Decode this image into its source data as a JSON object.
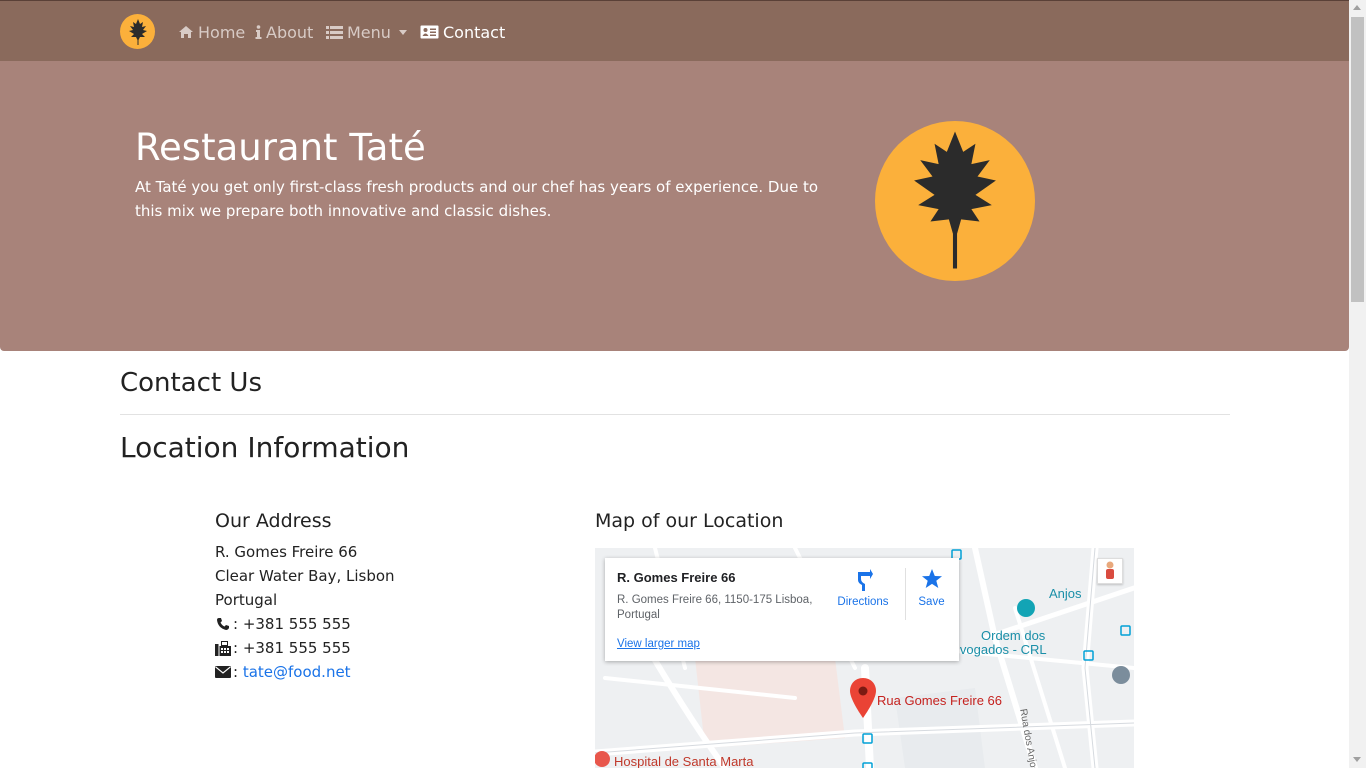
{
  "nav": {
    "items": [
      {
        "label": "Home",
        "icon": "home-icon"
      },
      {
        "label": "About",
        "icon": "info-icon"
      },
      {
        "label": "Menu",
        "icon": "list-icon"
      },
      {
        "label": "Contact",
        "icon": "address-card-icon"
      }
    ],
    "active": "Contact"
  },
  "hero": {
    "title": "Restaurant Taté",
    "text": "At Taté you get only first-class fresh products and our chef has years of experience. Due to this mix we prepare both innovative and classic dishes."
  },
  "contact": {
    "heading": "Contact Us",
    "location_heading": "Location Information"
  },
  "address": {
    "heading": "Our Address",
    "line1": "R. Gomes Freire 66",
    "line2": "Clear Water Bay, Lisbon",
    "line3": "Portugal",
    "phone": ": +381 555 555",
    "fax": ": +381 555 555",
    "email_prefix": ":",
    "email": "tate@food.net"
  },
  "map": {
    "heading": "Map of our Location",
    "card_title": "R. Gomes Freire 66",
    "card_address": "R. Gomes Freire 66, 1150-175 Lisboa, Portugal",
    "card_link": "View larger map",
    "directions_label": "Directions",
    "save_label": "Save",
    "pin_label": "Rua Gomes Freire 66",
    "label_anjos": "Anjos",
    "label_ordem": "Ordem dos",
    "label_advogados": "lvogados - CRL",
    "label_hospital": "Hospital de Santa Marta",
    "label_rua_anjos": "Rua dos Anjos"
  },
  "colors": {
    "navbar": "#8a6a5c",
    "hero": "#a8837a",
    "accent": "#fbb03b",
    "link": "#1a73e8"
  }
}
